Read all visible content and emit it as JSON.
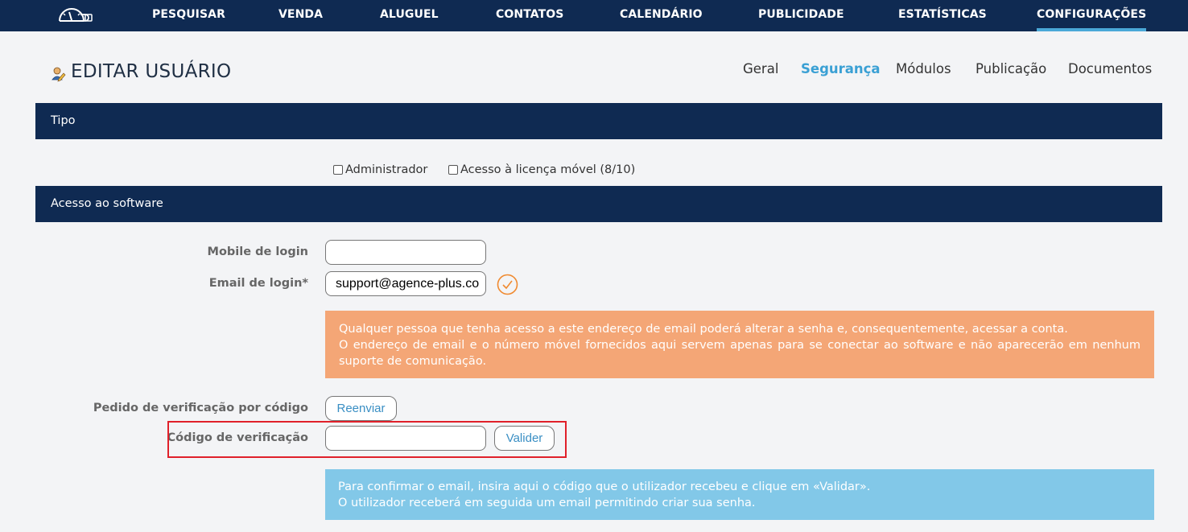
{
  "nav": {
    "items": [
      {
        "label": "PESQUISAR"
      },
      {
        "label": "VENDA"
      },
      {
        "label": "ALUGUEL"
      },
      {
        "label": "CONTATOS"
      },
      {
        "label": "CALENDÁRIO"
      },
      {
        "label": "PUBLICIDADE"
      },
      {
        "label": "ESTATÍSTICAS"
      },
      {
        "label": "CONFIGURAÇÕES"
      }
    ],
    "active": "CONFIGURAÇÕES"
  },
  "header": {
    "title": "EDITAR USUÁRIO",
    "tabs": [
      {
        "label": "Geral"
      },
      {
        "label": "Segurança"
      },
      {
        "label": "Módulos"
      },
      {
        "label": "Publicação"
      },
      {
        "label": "Documentos"
      }
    ],
    "active_tab": "Segurança"
  },
  "sections": {
    "tipo": "Tipo",
    "acesso": "Acesso ao software"
  },
  "tipo": {
    "admin_label": "Administrador",
    "admin_checked": false,
    "mobile_license_label": "Acesso à licença móvel (8/10)",
    "mobile_license_checked": false
  },
  "form": {
    "mobile_login_label": "Mobile de login",
    "mobile_login_value": "",
    "email_login_label": "Email de login*",
    "email_login_value": "support@agence-plus.co",
    "warning_line1": "Qualquer pessoa que tenha acesso a este endereço de email poderá alterar a senha e, consequentemente, acessar a conta.",
    "warning_line2": "O endereço de email e o número móvel fornecidos aqui servem apenas para se conectar ao software e não aparecerão em nenhum suporte de comunicação.",
    "verification_request_label": "Pedido de verificação por código",
    "resend_button": "Reenviar",
    "verification_code_label": "Código de verificação",
    "verification_code_value": "",
    "validate_button": "Valider",
    "info_line1": "Para confirmar o email, insira aqui o código que o utilizador recebeu e clique em «Validar».",
    "info_line2": "O utilizador receberá em seguida um email permitindo criar sua senha."
  },
  "colors": {
    "navbar": "#0f2a52",
    "accent": "#3aa0d4",
    "warning": "#f4a676",
    "info": "#82c8e8",
    "highlight": "#e0202a",
    "check": "#f08a30"
  },
  "icons": {
    "logo": "speedometer-icon",
    "user": "user-edit-icon",
    "email_status": "check-circle-icon"
  }
}
